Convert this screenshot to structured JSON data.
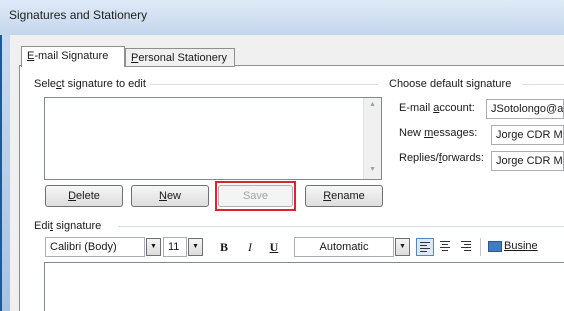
{
  "window": {
    "title": "Signatures and Stationery"
  },
  "tabs": [
    {
      "label": "E-mail Signature",
      "accel": "E",
      "rest": "-mail Signature"
    },
    {
      "label": "Personal Stationery",
      "accel": "P",
      "rest": "ersonal Stationery"
    }
  ],
  "select_group": {
    "pre": "Sele",
    "accel": "c",
    "post": "t signature to edit"
  },
  "buttons": {
    "delete": {
      "accel": "D",
      "rest": "elete"
    },
    "new": {
      "accel": "N",
      "rest": "ew"
    },
    "save": "Save",
    "rename": {
      "accel": "R",
      "rest": "ename"
    }
  },
  "defaults": {
    "title": "Choose default signature",
    "email_label": {
      "pre": "E-mail ",
      "accel": "a",
      "post": "ccount:"
    },
    "email_value": "JSotolongo@at",
    "new_label": {
      "pre": "New ",
      "accel": "m",
      "post": "essages:"
    },
    "new_value": "Jorge CDR M",
    "replies_label": {
      "pre": "Replies/",
      "accel": "f",
      "post": "orwards:"
    },
    "replies_value": "Jorge CDR M"
  },
  "edit": {
    "title_pre": "Edi",
    "title_accel": "t",
    "title_post": " signature",
    "font": "Calibri (Body)",
    "size": "11",
    "bold": "B",
    "italic": "I",
    "underline": "U",
    "color": "Automatic",
    "business_card": "Busine"
  }
}
